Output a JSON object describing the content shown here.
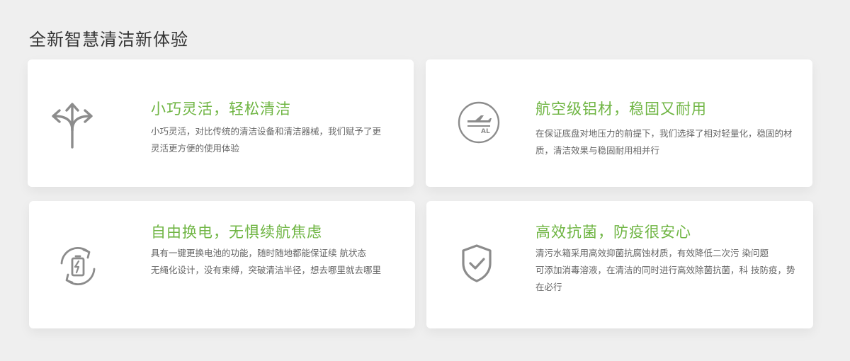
{
  "page": {
    "title": "全新智慧清洁新体验"
  },
  "colors": {
    "accent": "#6fb543",
    "icon": "#8c8c8c",
    "text": "#666666"
  },
  "cards": [
    {
      "icon": "direction-arrows-icon",
      "title": "小巧灵活，轻松清洁",
      "desc": [
        "小巧灵活，对比传统的清洁设备和清洁器械，我们赋予了更灵活更方便的使用体验"
      ]
    },
    {
      "icon": "airplane-al-icon",
      "icon_text": "AL",
      "title": "航空级铝材，稳固又耐用",
      "desc": [
        "在保证底盘对地压力的前提下，我们选择了相对轻量化，稳固的材质，清洁效果与稳固耐用相并行"
      ]
    },
    {
      "icon": "battery-swap-icon",
      "title": "自由换电，无惧续航焦虑",
      "desc": [
        "具有一键更换电池的功能，随时随地都能保证续 航状态",
        "无绳化设计，没有束缚，突破清洁半径，想去哪里就去哪里"
      ]
    },
    {
      "icon": "shield-check-icon",
      "title": "高效抗菌，防疫很安心",
      "desc": [
        "清污水箱采用高效抑菌抗腐蚀材质，有效降低二次污 染问题",
        "可添加消毒溶液，在清洁的同时进行高效除菌抗菌，科 技防疫，势在必行"
      ]
    }
  ]
}
